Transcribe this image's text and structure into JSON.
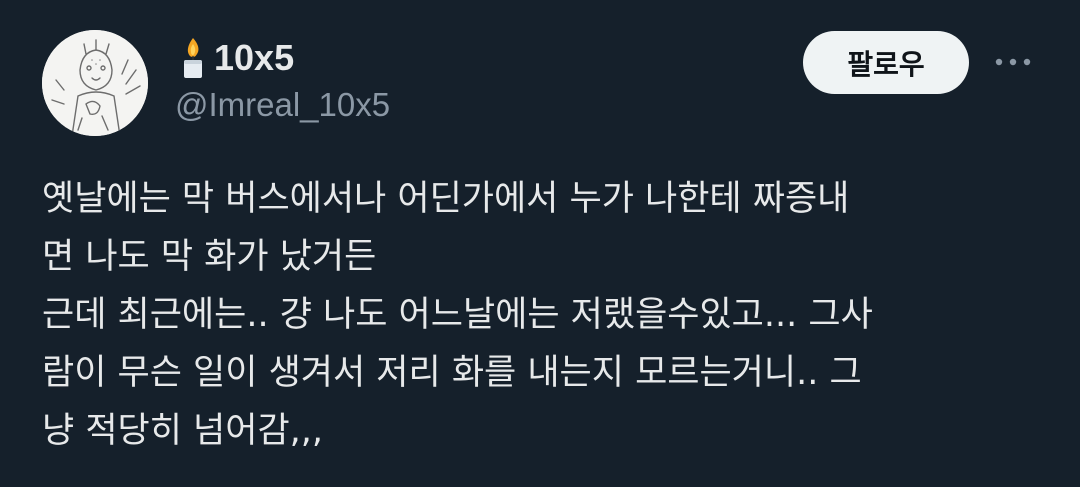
{
  "author": {
    "display_name": "10x5",
    "handle": "@Imreal_10x5",
    "name_emoji": "candle-icon",
    "avatar": "avatar-sketch-image"
  },
  "actions": {
    "follow_label": "팔로우",
    "more_icon": "more-icon"
  },
  "tweet": {
    "lines": [
      "옛날에는 막 버스에서나 어딘가에서 누가 나한테 짜증내",
      "면 나도 막 화가 났거든",
      "근데 최근에는.. 걍 나도 어느날에는 저랬을수있고... 그사",
      "람이 무슨 일이 생겨서 저리 화를 내는지 모르는거니.. 그",
      "냥 적당히 넘어감,,,"
    ]
  },
  "colors": {
    "background": "#15202b",
    "text": "#e7e9ea",
    "secondary_text": "#8b98a5",
    "follow_button_bg": "#eff3f4"
  }
}
